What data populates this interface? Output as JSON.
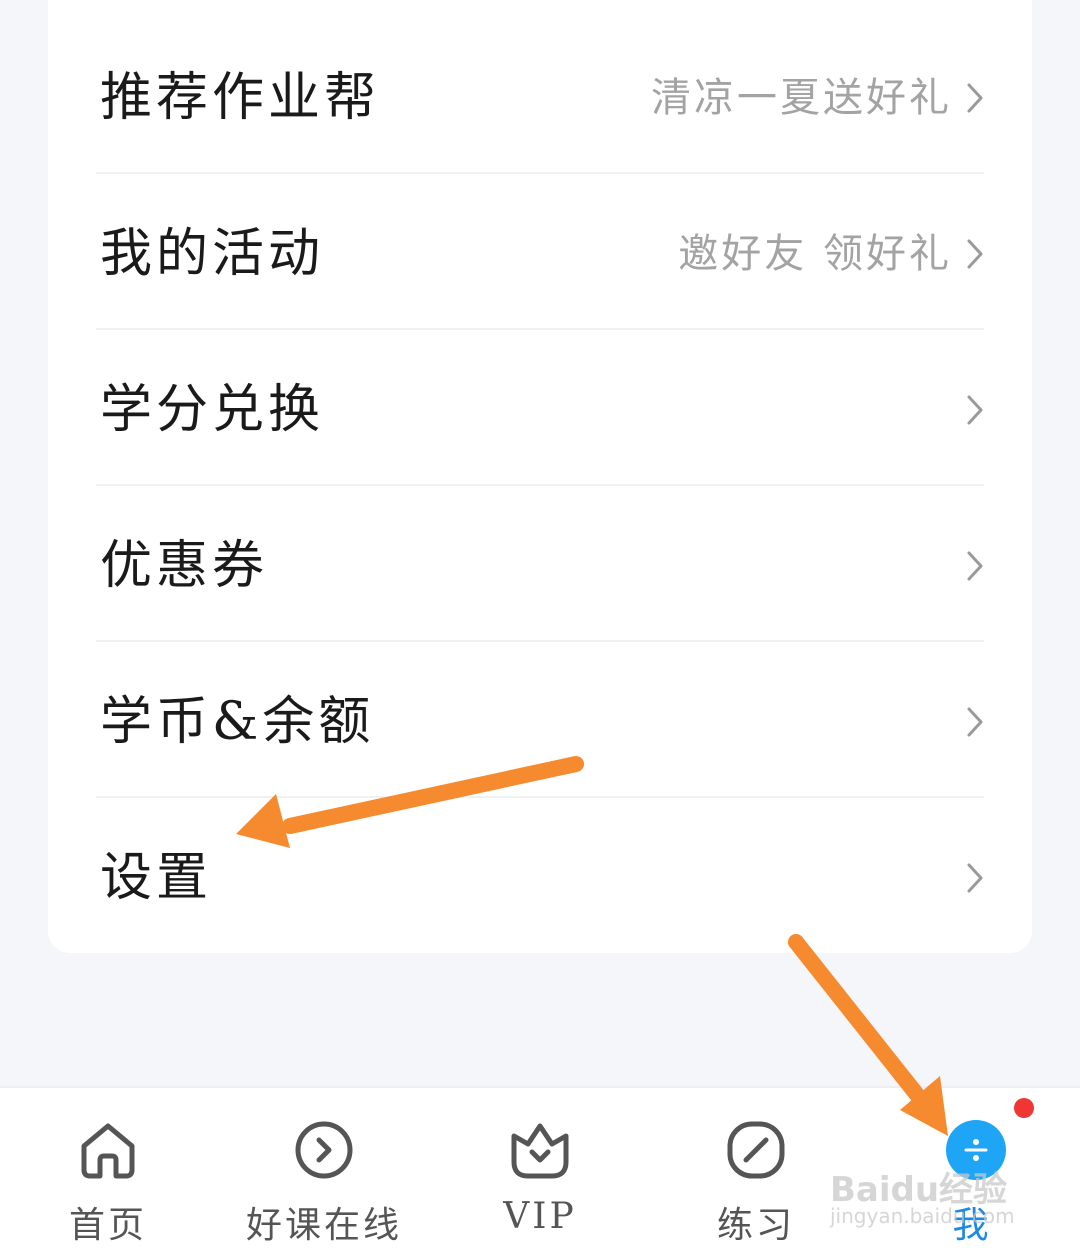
{
  "menu": {
    "items": [
      {
        "label": "推荐作业帮",
        "hint": "清凉一夏送好礼"
      },
      {
        "label": "我的活动",
        "hint": "邀好友 领好礼"
      },
      {
        "label": "学分兑换",
        "hint": ""
      },
      {
        "label": "优惠券",
        "hint": ""
      },
      {
        "label": "学币&余额",
        "hint": ""
      },
      {
        "label": "设置",
        "hint": ""
      }
    ]
  },
  "tabbar": {
    "tabs": [
      {
        "label": "首页",
        "icon": "home-icon"
      },
      {
        "label": "好课在线",
        "icon": "play-circle-icon"
      },
      {
        "label": "VIP",
        "icon": "crown-basket-icon"
      },
      {
        "label": "练习",
        "icon": "pencil-icon"
      },
      {
        "label": "我",
        "icon": "me-icon"
      }
    ],
    "active_index": 4,
    "active_color": "#1e88e5",
    "badge_color": "#f03535"
  },
  "annotations": {
    "arrow_color": "#f58a2e"
  },
  "watermark": {
    "line1": "Baidu经验",
    "line2": "jingyan.baidu.com"
  }
}
